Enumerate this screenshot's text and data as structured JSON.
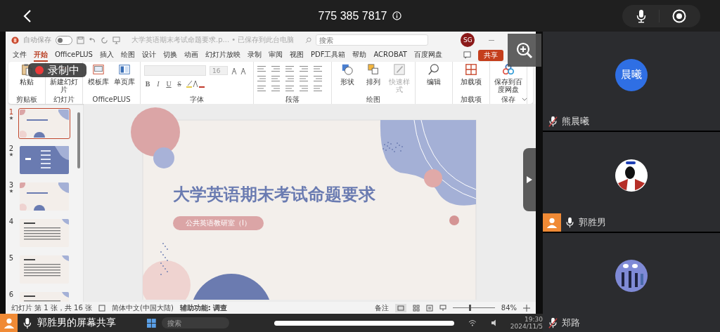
{
  "call": {
    "title": "775 385 7817"
  },
  "ppt": {
    "autosave_label": "自动保存",
    "autosave_on": false,
    "doc_title": "大学英语期末考试命题要求.p... • 已保存到此台电脑",
    "search_placeholder": "搜索",
    "user_initials": "SG",
    "tabs": [
      {
        "label": "文件",
        "selected": false
      },
      {
        "label": "开始",
        "selected": true
      },
      {
        "label": "OfficePLUS",
        "selected": false
      },
      {
        "label": "插入",
        "selected": false
      },
      {
        "label": "绘图",
        "selected": false
      },
      {
        "label": "设计",
        "selected": false
      },
      {
        "label": "切换",
        "selected": false
      },
      {
        "label": "动画",
        "selected": false
      },
      {
        "label": "幻灯片放映",
        "selected": false
      },
      {
        "label": "录制",
        "selected": false
      },
      {
        "label": "审阅",
        "selected": false
      },
      {
        "label": "视图",
        "selected": false
      },
      {
        "label": "PDF工具箱",
        "selected": false
      },
      {
        "label": "帮助",
        "selected": false
      },
      {
        "label": "ACROBAT",
        "selected": false
      },
      {
        "label": "百度网盘",
        "selected": false
      }
    ],
    "share_label": "共享",
    "ribbon": [
      {
        "label": "剪贴板",
        "kind": "tools",
        "tools": [
          {
            "label": "粘贴",
            "kind": "paste",
            "disabled": false
          }
        ]
      },
      {
        "label": "幻灯片",
        "kind": "tools",
        "tools": [
          {
            "label": "新建幻灯片",
            "kind": "new-slide",
            "disabled": false
          }
        ]
      },
      {
        "label": "OfficePLUS",
        "kind": "tools",
        "tools": [
          {
            "label": "模板库",
            "kind": "template",
            "disabled": false
          },
          {
            "label": "单页库",
            "kind": "page",
            "disabled": false
          }
        ]
      },
      {
        "label": "字体",
        "kind": "font",
        "font_size": "16",
        "format": [
          "B",
          "I",
          "U",
          "S"
        ]
      },
      {
        "label": "段落",
        "kind": "paragraph"
      },
      {
        "label": "绘图",
        "kind": "tools",
        "tools": [
          {
            "label": "形状",
            "kind": "shape",
            "disabled": false
          },
          {
            "label": "排列",
            "kind": "arrange",
            "disabled": false
          },
          {
            "label": "快速样式",
            "kind": "style",
            "disabled": true
          }
        ]
      },
      {
        "kind": "tools",
        "tools": [
          {
            "label": "编辑",
            "kind": "find",
            "disabled": false
          }
        ]
      },
      {
        "label": "加载项",
        "kind": "tools",
        "tools": [
          {
            "label": "加载项",
            "kind": "addin",
            "disabled": false
          }
        ]
      },
      {
        "label": "保存",
        "kind": "tools",
        "tools": [
          {
            "label": "保存到百度网盘",
            "kind": "cloud",
            "disabled": false
          }
        ]
      }
    ],
    "recording_label": "录制中",
    "slides": [
      {
        "number": "1",
        "kind": "title",
        "selected": true,
        "has_animation": true
      },
      {
        "number": "2",
        "kind": "agenda",
        "selected": false,
        "has_animation": true
      },
      {
        "number": "3",
        "kind": "section",
        "selected": false,
        "has_animation": true
      },
      {
        "number": "4",
        "kind": "text",
        "selected": false,
        "has_animation": false
      },
      {
        "number": "5",
        "kind": "text",
        "selected": false,
        "has_animation": false
      },
      {
        "number": "6",
        "kind": "text",
        "selected": false,
        "has_animation": false
      }
    ],
    "slide": {
      "title": "大学英语期末考试命题要求",
      "subtitle": "公共英语教研室（I）"
    },
    "status": {
      "slide_count": "幻灯片 第 1 张，共 16 张",
      "language": "简体中文(中国大陆)",
      "accessibility": "辅助功能: 调查",
      "notes": "备注",
      "zoom_slider": {
        "level": 0.4
      },
      "zoom_percent": "84%"
    }
  },
  "share_bar": {
    "label": "郭胜男的屏幕共享"
  },
  "taskbar": {
    "search_placeholder": "搜索",
    "time": "19:30",
    "date": "2024/11/5"
  },
  "participants": [
    {
      "name": "熊晨曦",
      "kind": "initials",
      "initials": "晨曦",
      "muted": true,
      "person_badge": false
    },
    {
      "name": "郭胜男",
      "kind": "cartoon",
      "muted": false,
      "person_badge": true
    },
    {
      "name": "郑路",
      "kind": "illustration",
      "muted": true,
      "person_badge": false
    }
  ]
}
